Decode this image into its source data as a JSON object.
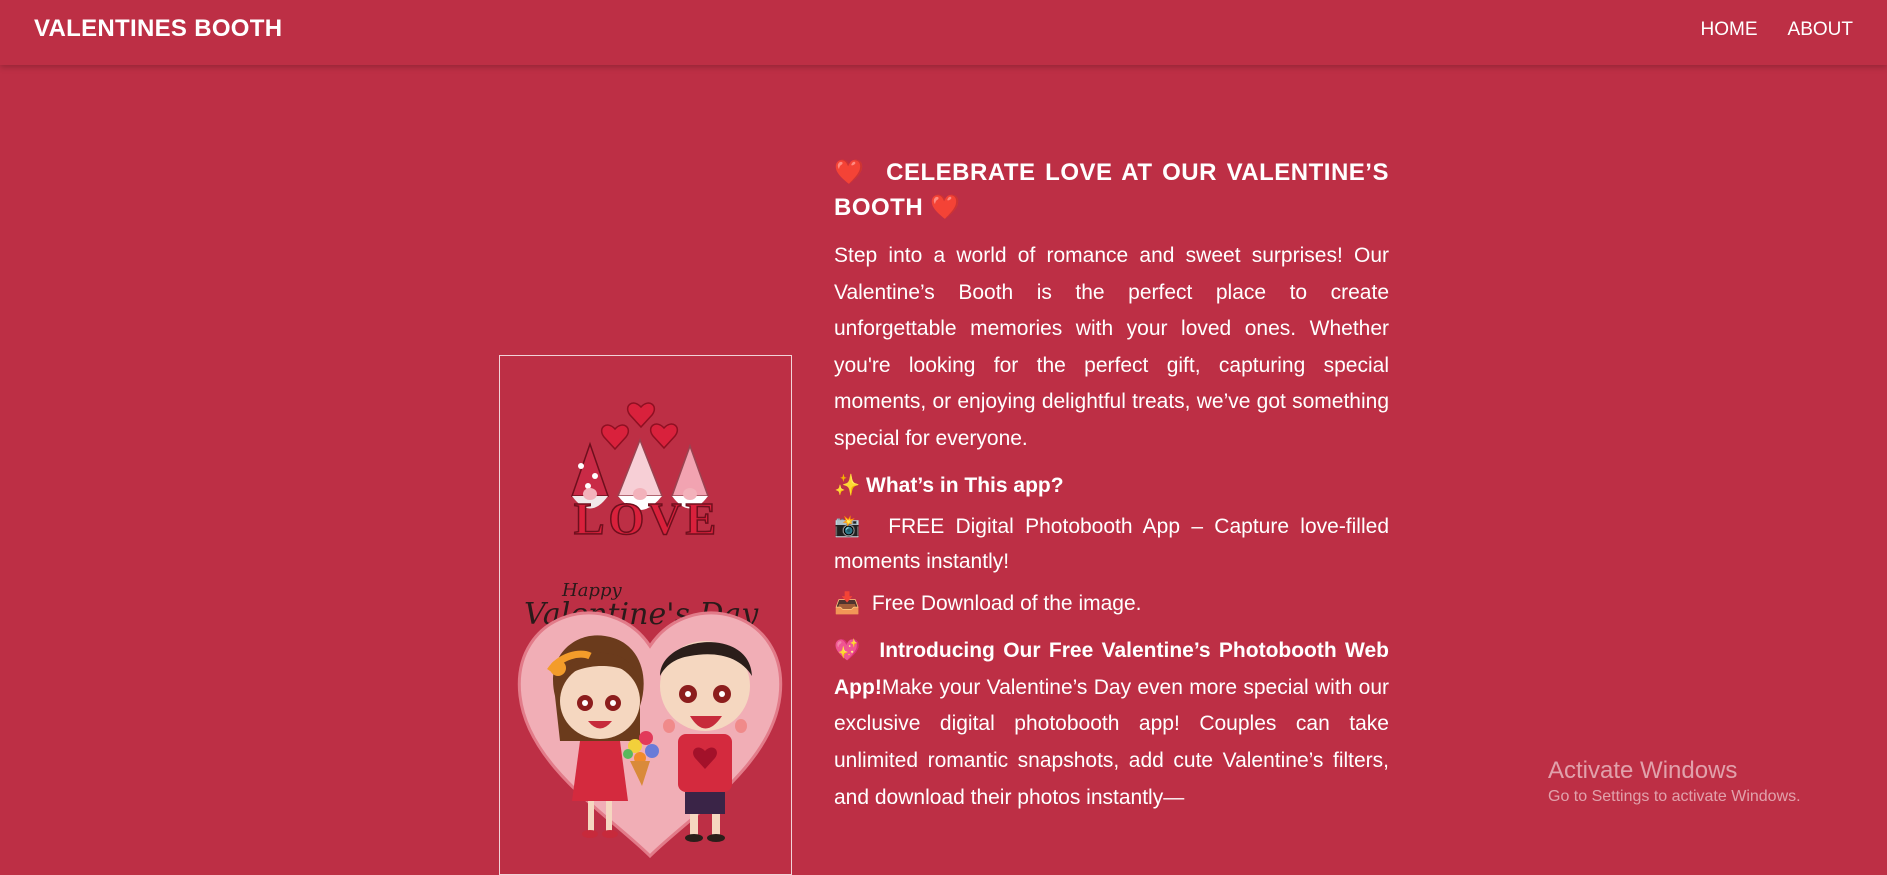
{
  "navbar": {
    "brand": "VALENTINES BOOTH",
    "links": [
      "HOME",
      "ABOUT"
    ]
  },
  "illustration": {
    "top_word": "LOVE",
    "script_small": "Happy",
    "script_large": "Valentine's Day"
  },
  "content": {
    "heading_icon": "❤️",
    "heading": "CELEBRATE LOVE AT OUR VALENTINE’S BOOTH",
    "intro": "Step into a world of romance and sweet surprises! Our Valentine’s Booth is the perfect place to create unforgettable memories with your loved ones. Whether you're looking for the perfect gift, capturing special moments, or enjoying delightful treats, we’ve got something special for everyone.",
    "section_icon": "✨",
    "section_title": "What’s in This app?",
    "features": [
      {
        "icon": "📸",
        "text": "FREE Digital Photobooth App – Capture love-filled moments instantly!"
      },
      {
        "icon": "📥",
        "text": "Free Download of the image."
      }
    ],
    "intro2_icon": "💖",
    "intro2_bold": "Introducing Our Free Valentine’s Photobooth Web App!",
    "intro2_text": "Make your Valentine’s Day even more special with our exclusive digital photobooth app! Couples can take unlimited romantic snapshots, add cute Valentine’s filters, and download their photos instantly—"
  },
  "watermark": {
    "title": "Activate Windows",
    "subtitle": "Go to Settings to activate Windows."
  },
  "colors": {
    "background": "#bd2f45",
    "text": "#ffffff",
    "heart": "#e8344f"
  }
}
